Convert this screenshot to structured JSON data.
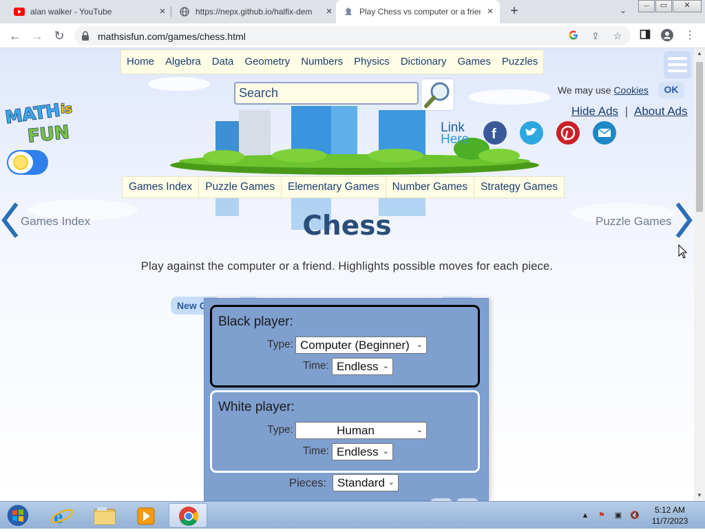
{
  "browser": {
    "tabs": [
      {
        "title": "alan walker - YouTube",
        "favicon": "youtube-icon",
        "active": false
      },
      {
        "title": "https://nepx.github.io/halfix-dem",
        "favicon": "globe-icon",
        "active": false
      },
      {
        "title": "Play Chess vs computer or a frien",
        "favicon": "chess-icon",
        "active": true
      }
    ],
    "new_tab_symbol": "+",
    "tab_close_symbol": "×",
    "url": "mathsisfun.com/games/chess.html",
    "window_controls": {
      "minimize": "—",
      "maximize": "▭",
      "close": "✕"
    }
  },
  "site": {
    "nav": [
      "Home",
      "Algebra",
      "Data",
      "Geometry",
      "Numbers",
      "Physics",
      "Dictionary",
      "Games",
      "Puzzles"
    ],
    "search_placeholder": "Search",
    "cookie_prefix": "We may use",
    "cookie_link": "Cookies",
    "ok_label": "OK",
    "hide_ads": "Hide Ads",
    "ad_separator": "|",
    "about_ads": "About Ads",
    "logo_text": {
      "maths": "MATH",
      "is": "is",
      "fun": "FUN"
    },
    "link_here": [
      "Link",
      "Here"
    ],
    "social": [
      {
        "name": "facebook",
        "color": "#3b5998",
        "glyph": "f"
      },
      {
        "name": "twitter",
        "color": "#2ea7e0",
        "glyph": "t"
      },
      {
        "name": "pinterest",
        "color": "#cb2027",
        "glyph": "p"
      },
      {
        "name": "email",
        "color": "#1e88c7",
        "glyph": "✉"
      }
    ],
    "subnav": [
      "Games Index",
      "Puzzle Games",
      "Elementary Games",
      "Number Games",
      "Strategy Games"
    ],
    "prev_label": "Games Index",
    "next_label": "Puzzle Games",
    "title": "Chess",
    "intro": "Play against the computer or a friend. Highlights possible moves for each piece."
  },
  "game": {
    "new_game_label": "New Game",
    "black_player": {
      "title": "Black player:",
      "type_label": "Type:",
      "type_value": "Computer (Beginner)",
      "time_label": "Time:",
      "time_value": "Endless"
    },
    "white_player": {
      "title": "White player:",
      "type_label": "Type:",
      "type_value": "Human",
      "time_label": "Time:",
      "time_value": "Endless"
    },
    "pieces_label": "Pieces:",
    "pieces_value": "Standard"
  },
  "taskbar": {
    "time": "5:12 AM",
    "date": "11/7/2023",
    "apps": [
      "internet-explorer-icon",
      "file-explorer-icon",
      "media-player-icon",
      "chrome-icon"
    ]
  }
}
